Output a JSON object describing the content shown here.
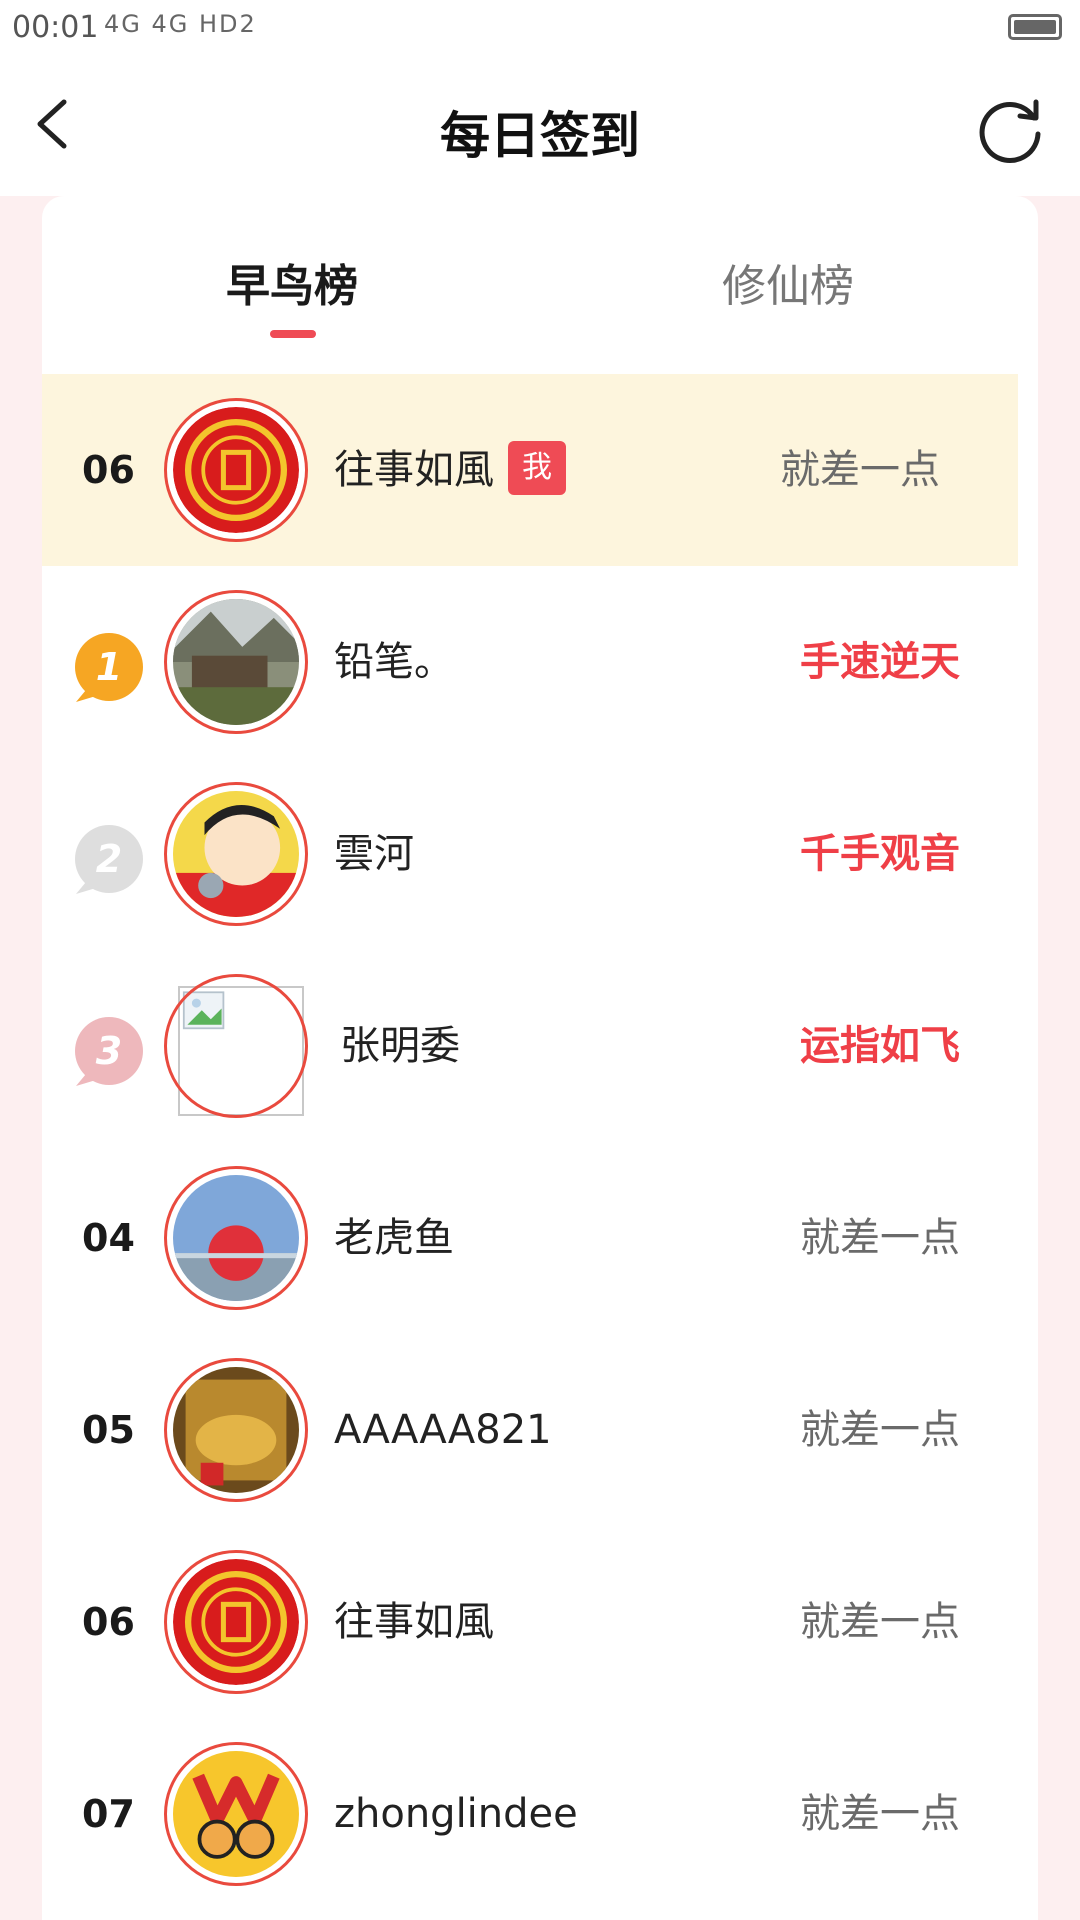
{
  "status_bar": {
    "time": "00:01",
    "indicators": "4G 4G HD2"
  },
  "navbar": {
    "title": "每日签到",
    "back_icon": "chevron-left-icon",
    "refresh_icon": "refresh-icon"
  },
  "tabs": [
    {
      "label": "早鸟榜",
      "active": true
    },
    {
      "label": "修仙榜",
      "active": false
    }
  ],
  "colors": {
    "accent": "#ef4b55",
    "avatar_ring": "#e94a3e",
    "highlight_row": "#fdf5dd"
  },
  "ranking": [
    {
      "rank": "06",
      "name": "往事如風",
      "me_badge": "我",
      "status": "就差一点",
      "highlight": true
    },
    {
      "rank": "1",
      "medal": "gold",
      "name": "铅笔。",
      "status": "手速逆天"
    },
    {
      "rank": "2",
      "medal": "silver",
      "name": "雲河",
      "status": "千手观音"
    },
    {
      "rank": "3",
      "medal": "bronze",
      "name": "张明委",
      "status": "运指如飞"
    },
    {
      "rank": "04",
      "name": "老虎鱼",
      "status": "就差一点"
    },
    {
      "rank": "05",
      "name": "AAAAA821",
      "status": "就差一点"
    },
    {
      "rank": "06",
      "name": "往事如風",
      "status": "就差一点"
    },
    {
      "rank": "07",
      "name": "zhonglindee",
      "status": "就差一点"
    }
  ]
}
